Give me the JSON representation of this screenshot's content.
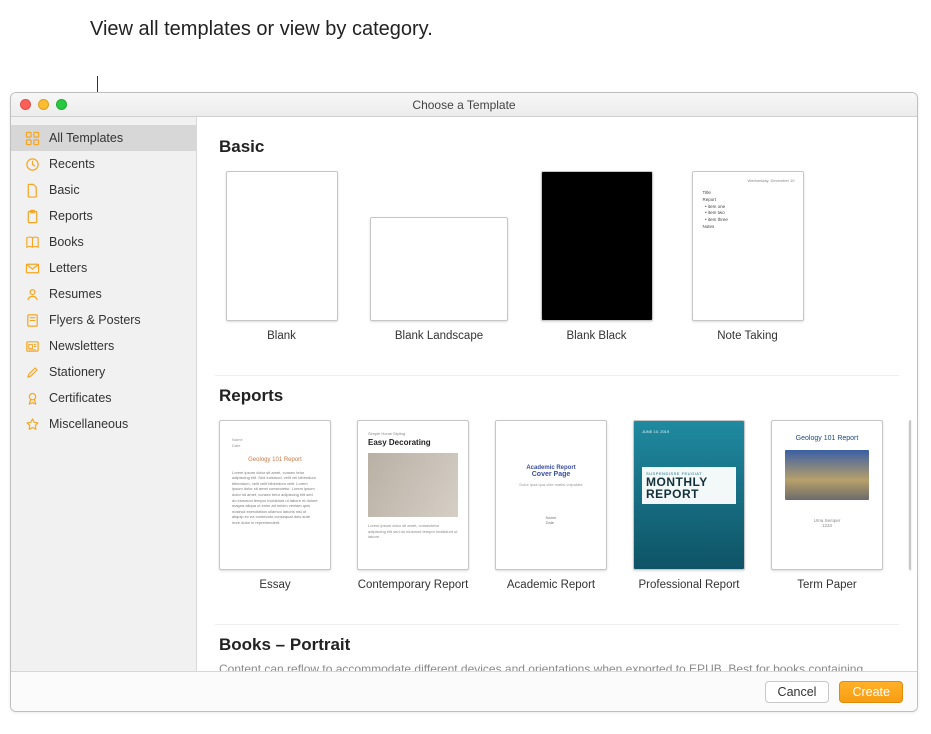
{
  "callout": "View all templates or view by category.",
  "window": {
    "title": "Choose a Template"
  },
  "sidebar": {
    "items": [
      {
        "label": "All Templates",
        "icon": "grid",
        "selected": true
      },
      {
        "label": "Recents",
        "icon": "clock",
        "selected": false
      },
      {
        "label": "Basic",
        "icon": "doc",
        "selected": false
      },
      {
        "label": "Reports",
        "icon": "clipboard",
        "selected": false
      },
      {
        "label": "Books",
        "icon": "book",
        "selected": false
      },
      {
        "label": "Letters",
        "icon": "envelope",
        "selected": false
      },
      {
        "label": "Resumes",
        "icon": "person",
        "selected": false
      },
      {
        "label": "Flyers & Posters",
        "icon": "poster",
        "selected": false
      },
      {
        "label": "Newsletters",
        "icon": "news",
        "selected": false
      },
      {
        "label": "Stationery",
        "icon": "pencil",
        "selected": false
      },
      {
        "label": "Certificates",
        "icon": "ribbon",
        "selected": false
      },
      {
        "label": "Miscellaneous",
        "icon": "star",
        "selected": false
      }
    ]
  },
  "sections": {
    "basic": {
      "title": "Basic",
      "templates": [
        {
          "label": "Blank"
        },
        {
          "label": "Blank Landscape"
        },
        {
          "label": "Blank Black"
        },
        {
          "label": "Note Taking"
        }
      ]
    },
    "reports": {
      "title": "Reports",
      "templates": [
        {
          "label": "Essay",
          "thumb_title": "Geology 101 Report"
        },
        {
          "label": "Contemporary Report",
          "thumb_small": "Simple Home Styling",
          "thumb_title": "Easy Decorating"
        },
        {
          "label": "Academic Report",
          "thumb_line1": "Academic Report",
          "thumb_line2": "Cover Page"
        },
        {
          "label": "Professional Report",
          "thumb_line1": "MONTHLY",
          "thumb_line2": "REPORT"
        },
        {
          "label": "Term Paper",
          "thumb_title": "Geology 101 Report"
        }
      ]
    },
    "books": {
      "title": "Books – Portrait",
      "description": "Content can reflow to accommodate different devices and orientations when exported to EPUB. Best for books containing primarily text."
    }
  },
  "footer": {
    "cancel": "Cancel",
    "create": "Create"
  },
  "colors": {
    "accent": "#f5a623"
  }
}
